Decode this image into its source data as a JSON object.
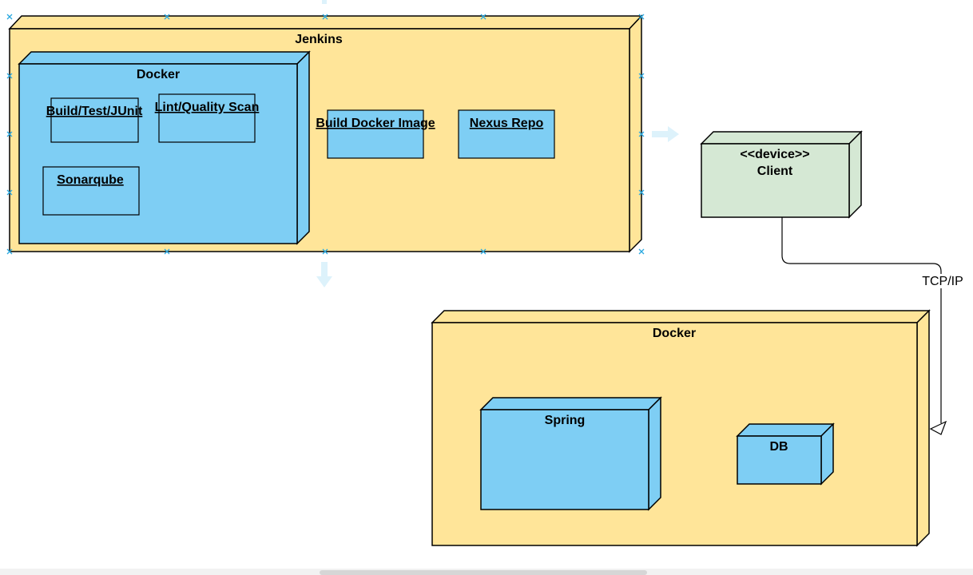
{
  "diagram": {
    "jenkins": {
      "label": "Jenkins"
    },
    "docker_ci": {
      "label": "Docker"
    },
    "build_test": {
      "label": "Build/Test/JUnit"
    },
    "lint_scan": {
      "label": "Lint/Quality Scan"
    },
    "sonarqube": {
      "label": "Sonarqube"
    },
    "build_image": {
      "label": "Build Docker Image"
    },
    "nexus": {
      "label": "Nexus Repo"
    },
    "client": {
      "stereotype": "<<device>>",
      "label": "Client"
    },
    "edge": {
      "label": "TCP/IP"
    },
    "docker_runtime": {
      "label": "Docker"
    },
    "spring": {
      "label": "Spring"
    },
    "db": {
      "label": "DB"
    }
  },
  "colors": {
    "node_yellow": "#FFE599",
    "node_blue": "#7ECEF4",
    "node_green": "#D5E8D4",
    "stroke": "#000000",
    "selection": "#29A8E0",
    "hint_arrow": "#DDF2FB"
  }
}
